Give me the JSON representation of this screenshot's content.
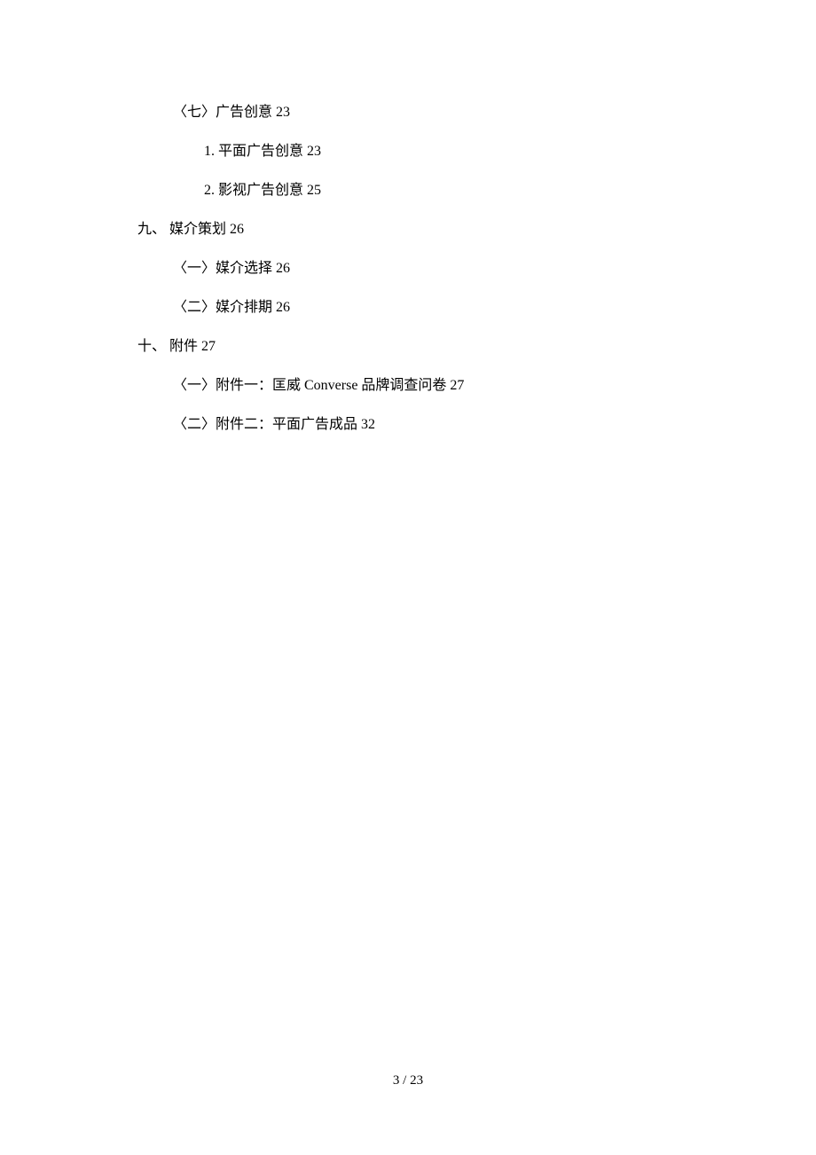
{
  "toc": {
    "lines": [
      {
        "level": 2,
        "text": "〈七〉广告创意 23"
      },
      {
        "level": 3,
        "text": "1.  平面广告创意 23"
      },
      {
        "level": 3,
        "text": "2.  影视广告创意 25"
      },
      {
        "level": 1,
        "text": "九、 媒介策划 26"
      },
      {
        "level": 2,
        "text": "〈一〉媒介选择 26"
      },
      {
        "level": 2,
        "text": "〈二〉媒介排期 26"
      },
      {
        "level": 1,
        "text": "十、 附件 27"
      },
      {
        "level": 2,
        "text": "〈一〉附件一：匡威 Converse 品牌调查问卷 27"
      },
      {
        "level": 2,
        "text": "〈二〉附件二：平面广告成品 32"
      }
    ]
  },
  "footer": {
    "page": "3  /  23"
  }
}
